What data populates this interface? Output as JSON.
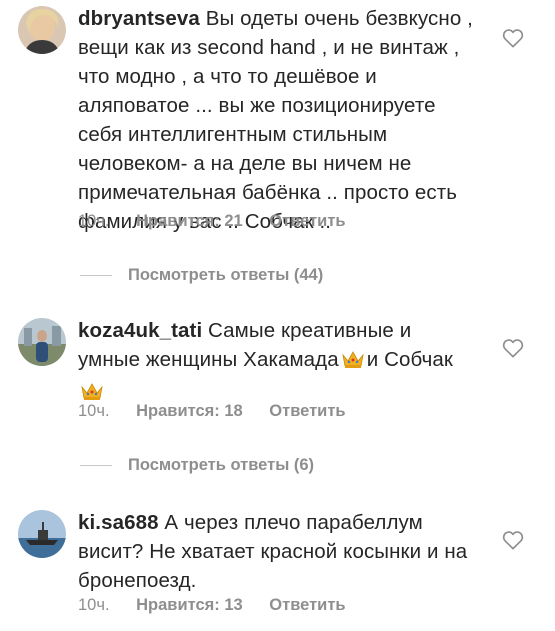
{
  "comments": [
    {
      "username": "dbryantseva",
      "text": "Вы одеты очень безвкусно , вещи как из second hand , и не винтаж , что модно , а что то дешёвое и аляповатое ... вы же позиционируете себя интеллигентным стильным человеком- а на деле вы ничем не примечательная бабёнка .. просто есть фамилия у вас .. Собчак ..",
      "time": "10ч.",
      "likes": "Нравится: 21",
      "reply": "Ответить",
      "view_replies": "Посмотреть ответы (44)"
    },
    {
      "username": "koza4uk_tati",
      "text_part1": "Самые креативные и умные  женщины  Хакамада",
      "text_part2": "и Собчак",
      "time": "10ч.",
      "likes": "Нравится: 18",
      "reply": "Ответить",
      "view_replies": "Посмотреть ответы (6)"
    },
    {
      "username": "ki.sa688",
      "text": "А через плечо парабеллум висит? Не хватает красной косынки и на бронепоезд.",
      "time": "10ч.",
      "likes": "Нравится: 13",
      "reply": "Ответить"
    }
  ],
  "icons": {
    "heart": "heart-outline-icon",
    "crown": "crown-emoji-icon"
  },
  "colors": {
    "text": "#262626",
    "secondary": "#8e8e8e",
    "divider": "#c7c7c7"
  }
}
